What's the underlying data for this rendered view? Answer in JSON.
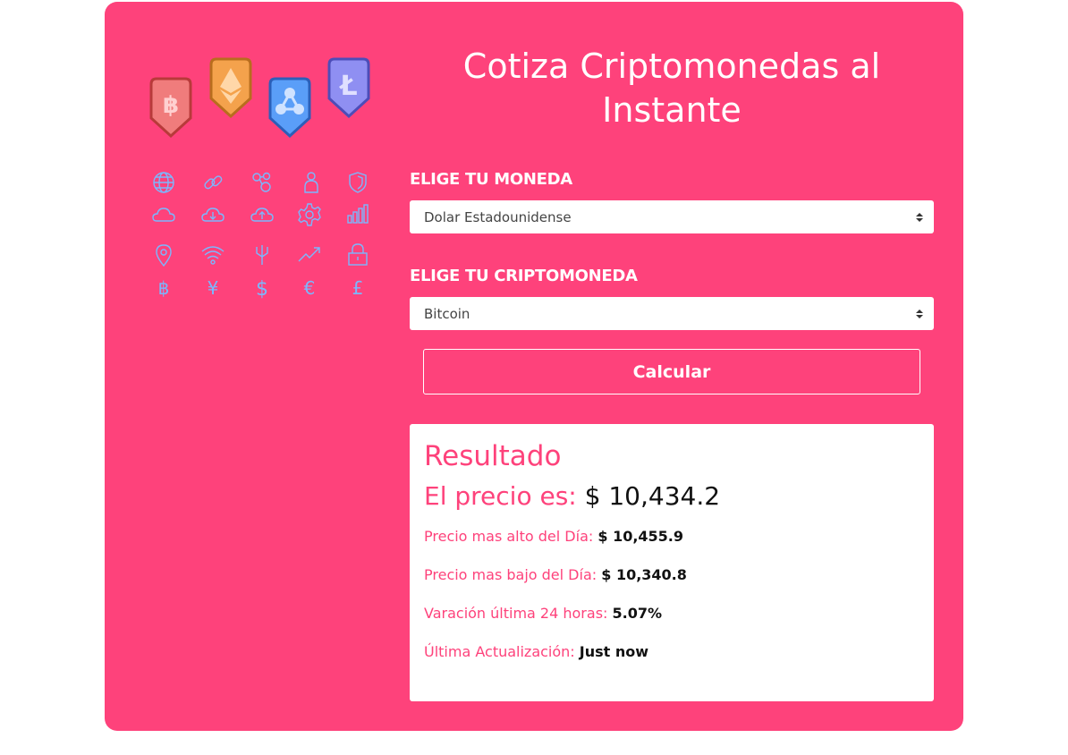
{
  "header": {
    "title_line1": "Cotiza Criptomonedas al",
    "title_line2": "Instante"
  },
  "coins": [
    {
      "name": "bitcoin",
      "symbol": "฿",
      "fill": "#f07c7c",
      "stroke": "#b83a3a"
    },
    {
      "name": "ethereum",
      "symbol": "eth",
      "fill": "#f4a24c",
      "stroke": "#b86d1e"
    },
    {
      "name": "ripple",
      "symbol": "xrp",
      "fill": "#5a9ef8",
      "stroke": "#2c5fb8"
    },
    {
      "name": "litecoin",
      "symbol": "Ł",
      "fill": "#8f8ff2",
      "stroke": "#4d4db8"
    }
  ],
  "icon_grid": [
    "globe-icon",
    "link-icon",
    "share-icon",
    "user-icon",
    "shield-icon",
    "cloud-icon",
    "cloud-download-icon",
    "cloud-upload-icon",
    "gear-icon",
    "signal-bars-icon",
    "map-pin-icon",
    "wifi-icon",
    "usb-icon",
    "trending-up-icon",
    "lock-icon",
    "bitcoin-icon",
    "yen-icon",
    "dollar-icon",
    "euro-icon",
    "pound-icon"
  ],
  "icon_color": "#7ab8ff",
  "form": {
    "currency_label": "ELIGE TU MONEDA",
    "currency_value": "Dolar Estadounidense",
    "crypto_label": "ELIGE TU CRIPTOMONEDA",
    "crypto_value": "Bitcoin",
    "submit_label": "Calcular"
  },
  "result": {
    "title": "Resultado",
    "price_label": "El precio es:",
    "price_value": "$ 10,434.2",
    "high_label": "Precio mas alto del Día:",
    "high_value": "$ 10,455.9",
    "low_label": "Precio mas bajo del Día:",
    "low_value": "$ 10,340.8",
    "change_label": "Varación última 24 horas:",
    "change_value": "5.07%",
    "updated_label": "Última Actualización:",
    "updated_value": "Just now"
  },
  "colors": {
    "background": "#fe427b",
    "accent": "#fe427b",
    "card": "#ffffff"
  }
}
